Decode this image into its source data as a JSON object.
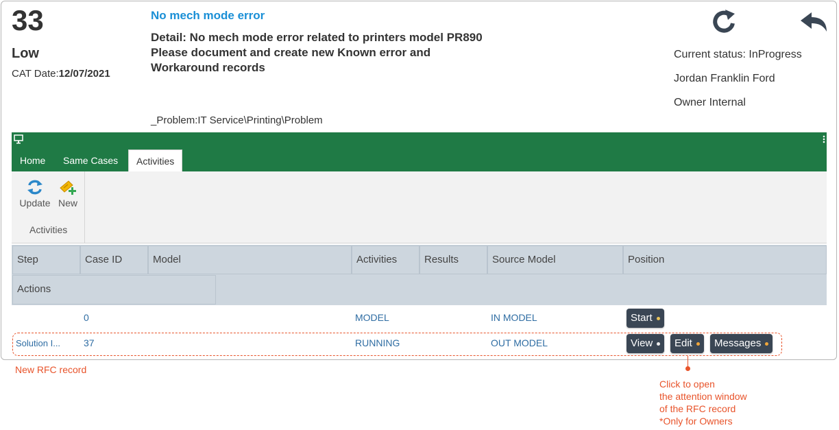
{
  "case": {
    "number": "33",
    "priority": "Low",
    "cat_date_label": "CAT Date:",
    "cat_date_value": "12/07/2021",
    "title": "No mech mode error",
    "detail_lines": [
      "Detail: No mech mode error related to printers model PR890",
      "Please document and create new Known error and",
      "Workaround records"
    ],
    "category": "_Problem:IT Service\\Printing\\Problem",
    "status": "Current status: InProgress",
    "person": "Jordan Franklin Ford",
    "owner": "Owner Internal"
  },
  "icons": {
    "refresh": "refresh-icon",
    "back": "reply-back-icon",
    "monitor": "monitor-icon",
    "kebab": "more-vertical-icon"
  },
  "tabs": [
    "Home",
    "Same Cases",
    "Activities"
  ],
  "active_tab": "Activities",
  "ribbon": {
    "update_label": "Update",
    "new_label": "New",
    "group_label": "Activities"
  },
  "grid": {
    "columns": [
      "Step",
      "Case ID",
      "Model",
      "Activities",
      "Results",
      "Source Model",
      "Position",
      "Actions"
    ],
    "rows": [
      {
        "step": "",
        "case_id": "0",
        "model": "",
        "activities": "MODEL",
        "results": "",
        "source_model": "IN MODEL",
        "buttons": [
          "Start"
        ]
      },
      {
        "step": "Solution I...",
        "case_id": "37",
        "model": "",
        "activities": "RUNNING",
        "results": "",
        "source_model": "OUT MODEL",
        "buttons": [
          "View",
          "Edit",
          "Messages"
        ]
      }
    ]
  },
  "annotations": {
    "row_note": "New RFC record",
    "button_note_lines": [
      "Click to open",
      "the attention window",
      "of the RFC record",
      "*Only for Owners"
    ]
  },
  "colors": {
    "accent_green": "#1f7a45",
    "title_blue": "#1a8fd6",
    "annotation_orange": "#e8532a",
    "button_dark": "#3a4654"
  }
}
